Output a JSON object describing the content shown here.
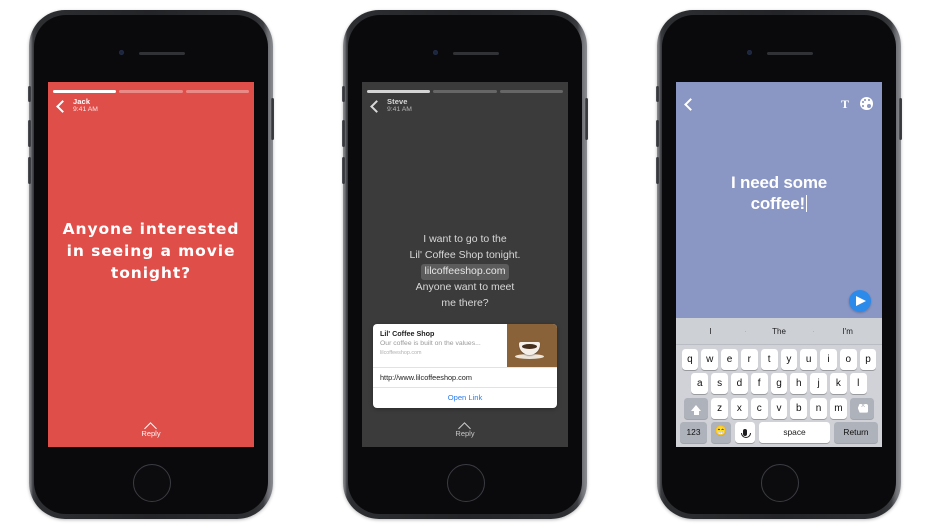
{
  "phones": [
    {
      "id": "story-view-jack",
      "background_color": "#e04e4a",
      "progress_segments": 3,
      "active_segment": 0,
      "header": {
        "back_icon": "chevron-left-icon",
        "name": "Jack",
        "time": "9:41 AM"
      },
      "message": "Anyone interested in seeing a movie tonight?",
      "reply": {
        "icon": "chevron-up-icon",
        "label": "Reply"
      }
    },
    {
      "id": "story-view-steve",
      "background_color": "#3b3b3b",
      "progress_segments": 3,
      "active_segment": 0,
      "header": {
        "back_icon": "chevron-left-icon",
        "name": "Steve",
        "time": "9:41 AM"
      },
      "message_line_1": "I want to go to the",
      "message_line_2": "Lil' Coffee Shop tonight.",
      "message_link": "lilcoffeeshop.com",
      "message_line_3": "Anyone want to meet",
      "message_line_4": "me there?",
      "link_card": {
        "title": "Lil' Coffee Shop",
        "description": "Our coffee is built on the values...",
        "domain": "lilcoffeeshop.com",
        "thumbnail": "coffee-cup-photo",
        "url": "http://www.lilcoffeeshop.com",
        "open_link_label": "Open Link",
        "open_link_color": "#2c7ced"
      },
      "reply": {
        "icon": "chevron-up-icon",
        "label": "Reply"
      }
    },
    {
      "id": "story-composer",
      "background_color": "#8a96c4",
      "header": {
        "back_icon": "chevron-left-icon",
        "text_tool_label": "T",
        "palette_icon": "color-palette-icon"
      },
      "compose_line_1": "I need some",
      "compose_line_2": "coffee!",
      "send_button": {
        "icon": "send-paper-plane-icon",
        "color": "#2c8aeb"
      },
      "keyboard": {
        "predictions": [
          "I",
          "The",
          "I'm"
        ],
        "row_1": [
          "q",
          "w",
          "e",
          "r",
          "t",
          "y",
          "u",
          "i",
          "o",
          "p"
        ],
        "row_2": [
          "a",
          "s",
          "d",
          "f",
          "g",
          "h",
          "j",
          "k",
          "l"
        ],
        "row_3": [
          "z",
          "x",
          "c",
          "v",
          "b",
          "n",
          "m"
        ],
        "shift_icon": "shift-arrow-icon",
        "delete_icon": "backspace-delete-icon",
        "numbers_key": "123",
        "emoji_icon": "emoji-smiley-icon",
        "mic_icon": "microphone-icon",
        "space_key": "space",
        "return_key": "Return"
      }
    }
  ]
}
